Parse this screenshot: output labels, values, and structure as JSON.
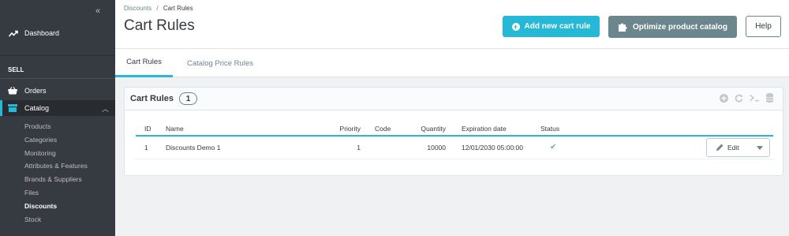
{
  "sidebar": {
    "collapse_label": "«",
    "dashboard": "Dashboard",
    "section_sell": "SELL",
    "orders": "Orders",
    "catalog": "Catalog",
    "submenu": [
      {
        "label": "Products",
        "active": false
      },
      {
        "label": "Categories",
        "active": false
      },
      {
        "label": "Monitoring",
        "active": false
      },
      {
        "label": "Attributes & Features",
        "active": false
      },
      {
        "label": "Brands & Suppliers",
        "active": false
      },
      {
        "label": "Files",
        "active": false
      },
      {
        "label": "Discounts",
        "active": true
      },
      {
        "label": "Stock",
        "active": false
      }
    ]
  },
  "header": {
    "breadcrumb_parent": "Discounts",
    "breadcrumb_sep": "/",
    "breadcrumb_current": "Cart Rules",
    "title": "Cart Rules",
    "add_button": "Add new cart rule",
    "optimize_button": "Optimize product catalog",
    "help_button": "Help"
  },
  "tabs": [
    {
      "label": "Cart Rules",
      "active": true
    },
    {
      "label": "Catalog Price Rules",
      "active": false
    }
  ],
  "card": {
    "title": "Cart Rules",
    "count": "1",
    "columns": {
      "id": "ID",
      "name": "Name",
      "priority": "Priority",
      "code": "Code",
      "quantity": "Quantity",
      "expiration": "Expiration date",
      "status": "Status"
    },
    "rows": [
      {
        "id": "1",
        "name": "Discounts Demo 1",
        "priority": "1",
        "code": "",
        "quantity": "10000",
        "expiration": "12/01/2030 05:00:00",
        "status": "enabled",
        "action": "Edit"
      }
    ]
  },
  "colors": {
    "accent": "#25b9d7",
    "sidebar_bg": "#363a41",
    "secondary_button": "#6c868e",
    "status_ok": "#70b580"
  }
}
